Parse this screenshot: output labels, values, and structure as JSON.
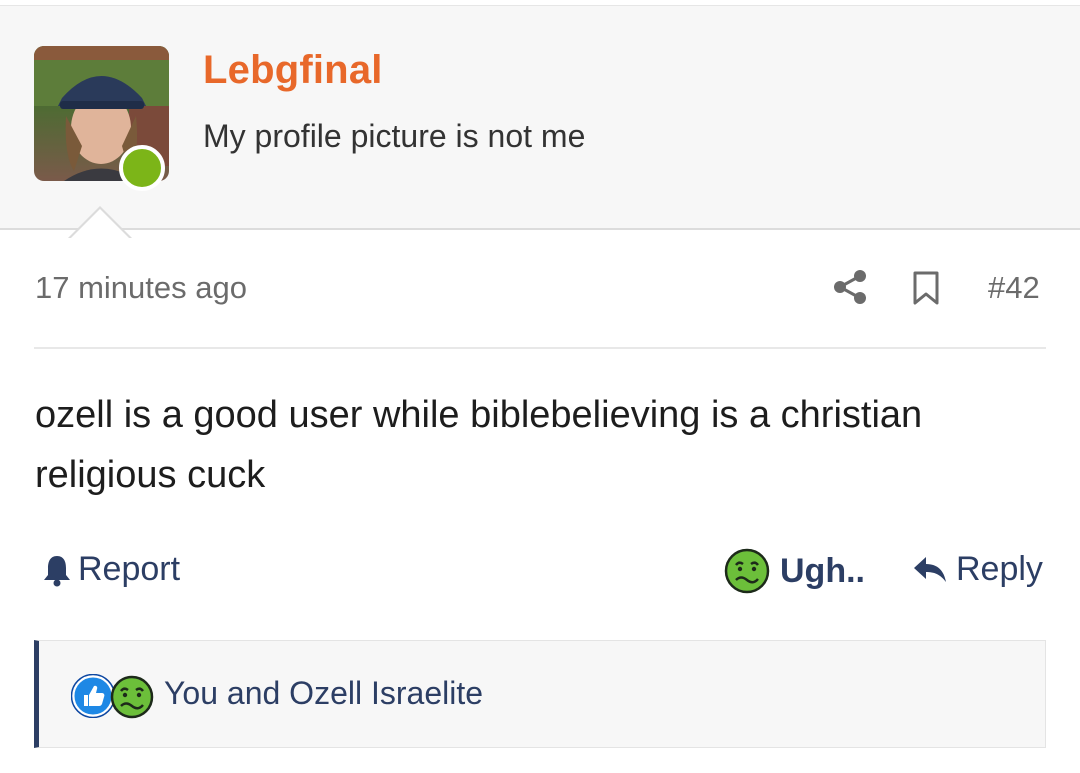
{
  "post": {
    "username": "Lebgfinal",
    "user_title": "My profile picture is not me",
    "time": "17 minutes ago",
    "post_number": "#42",
    "body": "ozell is a good user while biblebelieving is a christian religious cuck"
  },
  "actions": {
    "report_label": "Report",
    "reaction_label": "Ugh..",
    "reply_label": "Reply"
  },
  "reactions": {
    "summary": "You and Ozell Israelite",
    "icons": [
      "like-icon",
      "ugh-icon"
    ]
  },
  "colors": {
    "username": "#e8682a",
    "accent": "#2c3e64",
    "online": "#7cb518",
    "like": "#1e88e5",
    "ugh": "#6cbf3a"
  }
}
